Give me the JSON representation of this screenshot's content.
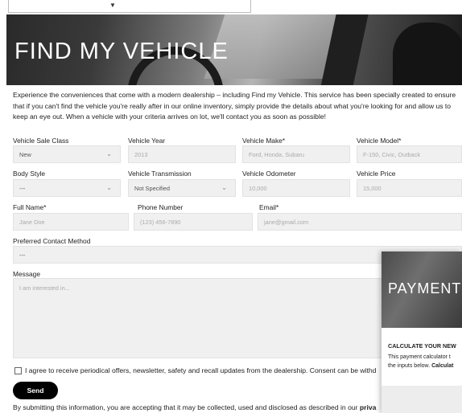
{
  "hero": {
    "title": "FIND MY VEHICLE"
  },
  "intro": "Experience the conveniences that come with a modern dealership – including Find my Vehicle. This service has been specially created to ensure that if you can't find the vehicle you're really after in our online inventory, simply provide the details about what you're looking for and allow us to keep an eye out. When a vehicle with your criteria arrives on lot, we'll contact you as soon as possible!",
  "form": {
    "sale_class": {
      "label": "Vehicle Sale Class",
      "value": "New"
    },
    "year": {
      "label": "Vehicle Year",
      "placeholder": "2013"
    },
    "make": {
      "label": "Vehicle Make*",
      "placeholder": "Ford, Honda, Subaru"
    },
    "model": {
      "label": "Vehicle Model*",
      "placeholder": "F-150, Civic, Outback"
    },
    "body_style": {
      "label": "Body Style",
      "value": "---"
    },
    "transmission": {
      "label": "Vehicle Transmission",
      "value": "Not Specified"
    },
    "odometer": {
      "label": "Vehicle Odometer",
      "placeholder": "10,000"
    },
    "price": {
      "label": "Vehicle Price",
      "placeholder": "15,000"
    },
    "full_name": {
      "label": "Full Name*",
      "placeholder": "Jane Doe"
    },
    "phone": {
      "label": "Phone Number",
      "placeholder": "(123) 456-7890"
    },
    "email": {
      "label": "Email*",
      "placeholder": "jane@gmail.com"
    },
    "contact_method": {
      "label": "Preferred Contact Method",
      "value": "---"
    },
    "message": {
      "label": "Message",
      "placeholder": "I am interested in..."
    },
    "consent": "I agree to receive periodical offers, newsletter, safety and recall updates from the dealership. Consent can be withd",
    "send_label": "Send",
    "footer_note": "By submitting this information, you are accepting that it may be collected, used and disclosed as described in our",
    "footer_link": "priva"
  },
  "payment_widget": {
    "title": "PAYMENT",
    "calc_heading": "CALCULATE YOUR NEW",
    "desc_line1": "This payment calculator t",
    "desc_line2": "the inputs below.",
    "desc_bold": "Calculat"
  },
  "icons": {
    "dropdown_caret": "chevron-down-icon",
    "checkbox": "checkbox-icon"
  }
}
